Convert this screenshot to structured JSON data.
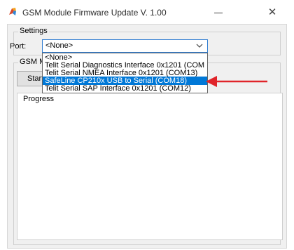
{
  "window": {
    "title": "GSM Module Firmware Update V. 1.00",
    "close_glyph": "✕"
  },
  "settings": {
    "group_label": "Settings",
    "port_label": "Port:",
    "port_value": "<None>"
  },
  "dropdown": {
    "options": [
      "<None>",
      "Telit Serial Diagnostics Interface 0x1201 (COM",
      "Telit Serial NMEA Interface 0x1201 (COM13)",
      "SafeLine CP210x USB to Serial (COM18)",
      "Telit Serial SAP Interface 0x1201 (COM12)"
    ],
    "highlighted_index": 3
  },
  "gsm": {
    "group_label": "GSM M",
    "start_button_label": "Start",
    "progress_label": "Progress"
  },
  "icons": {
    "app": "app-icon",
    "minimize": "minimize-icon",
    "close": "close-icon",
    "dropdown": "chevron-down-icon",
    "annotation": "red-arrow-icon"
  },
  "colors": {
    "selection": "#0078d7",
    "annotation_arrow": "#e0242a",
    "focus_border": "#2e7cd1"
  }
}
